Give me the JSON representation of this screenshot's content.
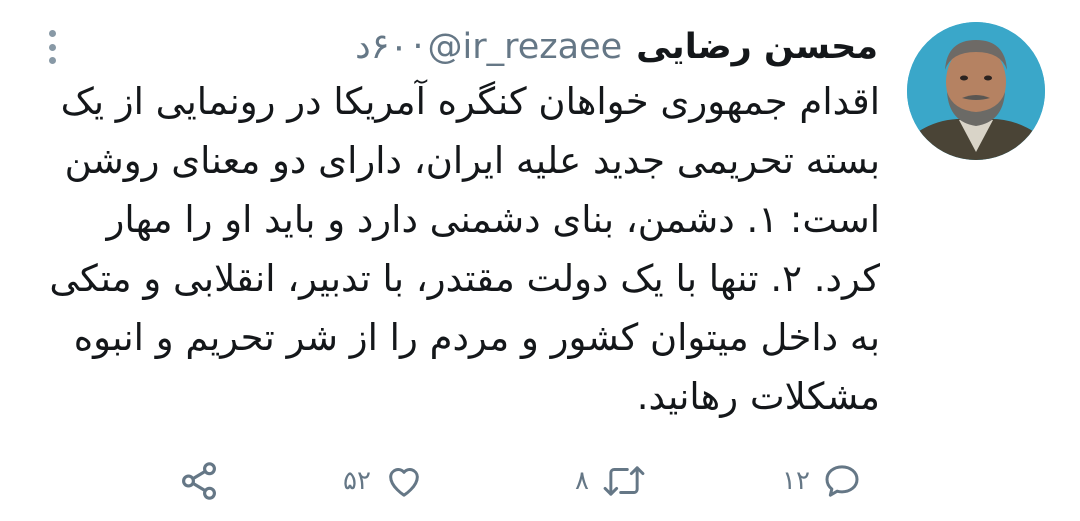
{
  "tweet": {
    "author_name": "محسن رضایی",
    "handle": "@ir_rezaee",
    "separator": "·",
    "time": "۶۰د",
    "text": "اقدام جمهوری خواهان کنگره آمریکا در رونمایی از یک بسته تحریمی جدید علیه ایران، دارای دو معنای روشن است: ۱. دشمن، بنای دشمنی دارد و باید او را مهار کرد. ۲. تنها با یک دولت مقتدر، با تدبیر، انقلابی و متکی به داخل میتوان کشور و مردم را از شر تحریم و انبوه مشکلات رهانید."
  },
  "actions": {
    "reply_count": "۱۲",
    "retweet_count": "۸",
    "like_count": "۵۲"
  },
  "icons": {
    "reply": "reply-icon",
    "retweet": "retweet-icon",
    "like": "heart-icon",
    "share": "share-icon",
    "more": "more-vertical-icon"
  },
  "colors": {
    "text": "#14171a",
    "muted": "#657786",
    "icon": "#657786",
    "avatar_bg": "#3aa7c9"
  }
}
